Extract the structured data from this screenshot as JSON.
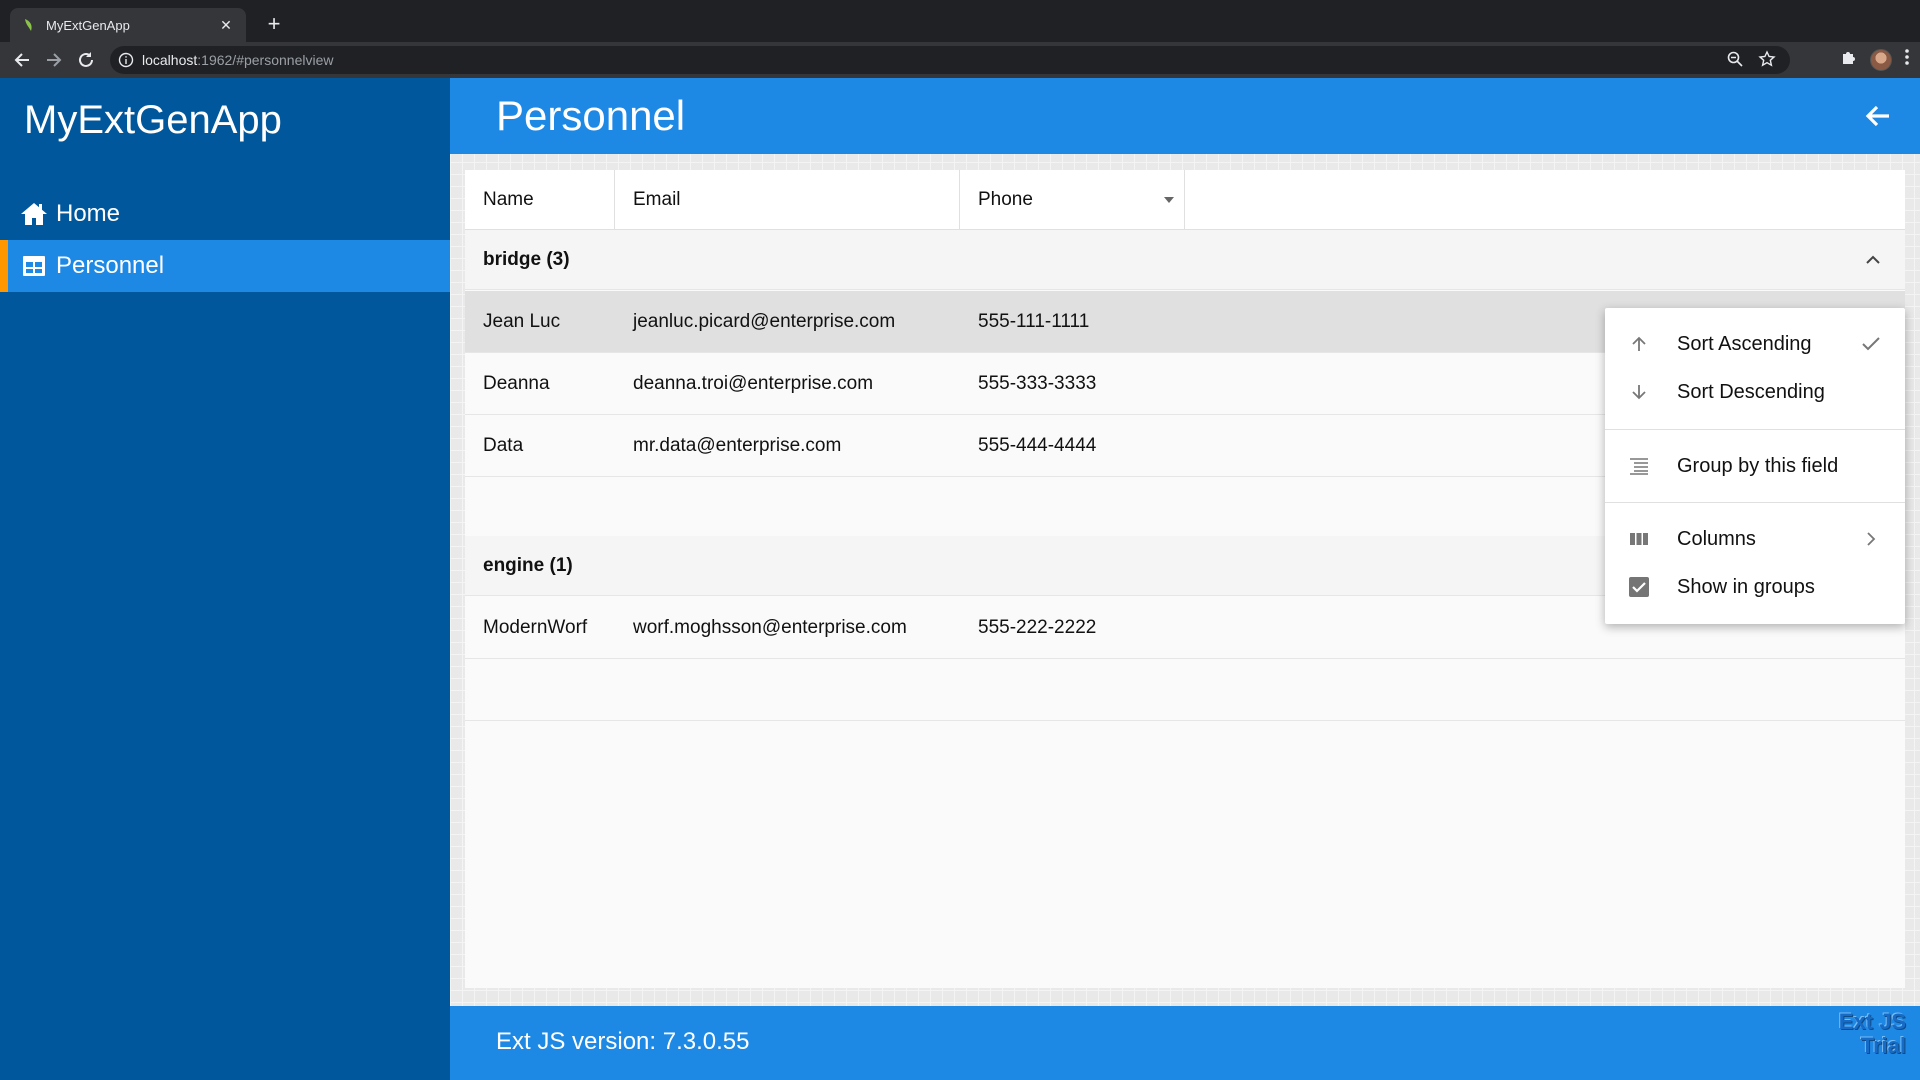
{
  "browser": {
    "tab_title": "MyExtGenApp",
    "tab_close": "✕",
    "new_tab": "+",
    "url_host": "localhost",
    "url_rest": ":1962/#personnelview"
  },
  "sidebar": {
    "app_title": "MyExtGenApp",
    "items": [
      {
        "label": "Home",
        "icon": "home-icon"
      },
      {
        "label": "Personnel",
        "icon": "grid-icon",
        "selected": true
      }
    ]
  },
  "header": {
    "title": "Personnel"
  },
  "grid": {
    "columns": [
      "Name",
      "Email",
      "Phone"
    ],
    "groups": [
      {
        "label": "bridge (3)",
        "rows": [
          {
            "name": "Jean Luc",
            "email": "jeanluc.picard@enterprise.com",
            "phone": "555-111-1111",
            "selected": true
          },
          {
            "name": "Deanna",
            "email": "deanna.troi@enterprise.com",
            "phone": "555-333-3333"
          },
          {
            "name": "Data",
            "email": "mr.data@enterprise.com",
            "phone": "555-444-4444"
          }
        ]
      },
      {
        "label": "engine (1)",
        "rows": [
          {
            "name": "ModernWorf",
            "email": "worf.moghsson@enterprise.com",
            "phone": "555-222-2222"
          }
        ]
      }
    ]
  },
  "menu": {
    "sort_asc": "Sort Ascending",
    "sort_desc": "Sort Descending",
    "group_by": "Group by this field",
    "columns": "Columns",
    "show_in_groups": "Show in groups",
    "show_in_groups_checked": true,
    "sort_asc_checked": true
  },
  "footer": {
    "version_text": "Ext JS version: 7.3.0.55",
    "trial_line1": "Ext JS",
    "trial_line2": "Trial"
  },
  "colors": {
    "sidebar_bg": "#01579b",
    "accent_blue": "#1e88e5",
    "selection_marker": "#ff9800"
  }
}
